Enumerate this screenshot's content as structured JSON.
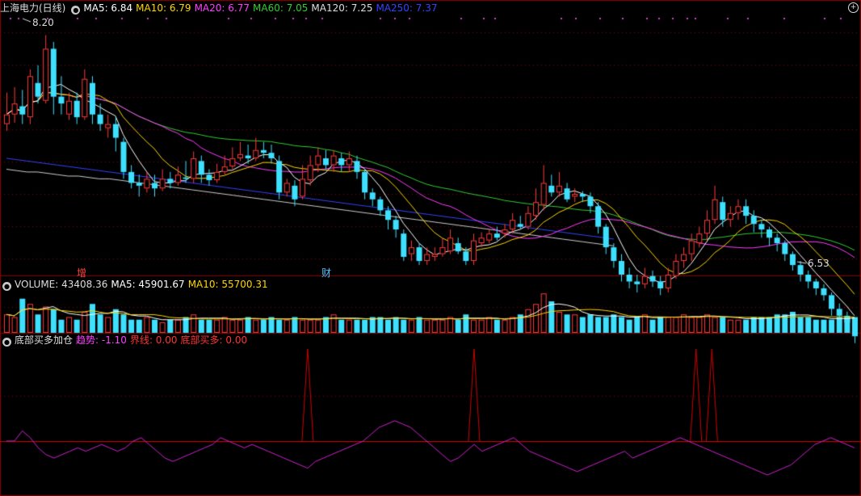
{
  "colors": {
    "up": "#ff3b3b",
    "down": "#3ee0ff",
    "ma5": "#ffffff",
    "ma10": "#ffd700",
    "ma20": "#ff3cff",
    "ma60": "#33cc33",
    "ma120": "#cccccc",
    "ma250": "#3344ff",
    "grid": "#8a0000",
    "trend": "#d020d0",
    "bottom": "#d00000"
  },
  "header": {
    "title": "上海电力(日线)",
    "ma5": "MA5: 6.84",
    "ma10": "MA10: 6.79",
    "ma20": "MA20: 6.77",
    "ma60": "MA60: 7.05",
    "ma120": "MA120: 7.25",
    "ma250": "MA250: 7.37"
  },
  "volume_header": {
    "title": "VOLUME: 43408.36",
    "ma5": "MA5: 45901.67",
    "ma10": "MA10: 55700.31"
  },
  "indicator_header": {
    "title": "底部买多加仓",
    "trend": "趋势: -1.10",
    "line": "界线: 0.00",
    "bottom": "底部买多: 0.00"
  },
  "annotations": {
    "high": "8.20",
    "low": "6.53",
    "marker1": "增",
    "marker2": "财"
  },
  "icons": {
    "panel": "settings-dot-icon",
    "corner": "expand-icon"
  },
  "chart_data": [
    {
      "type": "candlestick",
      "title": "上海电力(日线)",
      "ylim": [
        6.45,
        8.35
      ],
      "candles": [
        [
          7.55,
          7.62,
          7.78,
          7.5
        ],
        [
          7.62,
          7.7,
          7.82,
          7.56
        ],
        [
          7.68,
          7.62,
          7.8,
          7.55
        ],
        [
          7.6,
          7.9,
          7.95,
          7.55
        ],
        [
          7.85,
          7.75,
          7.98,
          7.7
        ],
        [
          7.72,
          8.1,
          8.2,
          7.7
        ],
        [
          8.1,
          7.75,
          8.15,
          7.62
        ],
        [
          7.75,
          7.7,
          7.9,
          7.62
        ],
        [
          7.62,
          7.72,
          7.78,
          7.58
        ],
        [
          7.72,
          7.6,
          7.78,
          7.55
        ],
        [
          7.6,
          7.88,
          7.95,
          7.58
        ],
        [
          7.85,
          7.62,
          7.9,
          7.55
        ],
        [
          7.62,
          7.55,
          7.7,
          7.5
        ],
        [
          7.52,
          7.55,
          7.62,
          7.45
        ],
        [
          7.55,
          7.45,
          7.6,
          7.35
        ],
        [
          7.42,
          7.2,
          7.45,
          7.15
        ],
        [
          7.2,
          7.12,
          7.25,
          7.08
        ],
        [
          7.12,
          7.1,
          7.18,
          7.02
        ],
        [
          7.08,
          7.15,
          7.2,
          7.05
        ],
        [
          7.12,
          7.08,
          7.18,
          7.02
        ],
        [
          7.08,
          7.15,
          7.22,
          7.06
        ],
        [
          7.15,
          7.12,
          7.2,
          7.08
        ],
        [
          7.12,
          7.18,
          7.24,
          7.1
        ],
        [
          7.16,
          7.15,
          7.28,
          7.12
        ],
        [
          7.15,
          7.3,
          7.35,
          7.12
        ],
        [
          7.28,
          7.18,
          7.32,
          7.12
        ],
        [
          7.18,
          7.14,
          7.22,
          7.1
        ],
        [
          7.14,
          7.2,
          7.26,
          7.12
        ],
        [
          7.2,
          7.24,
          7.32,
          7.18
        ],
        [
          7.24,
          7.3,
          7.38,
          7.22
        ],
        [
          7.3,
          7.33,
          7.42,
          7.28
        ],
        [
          7.32,
          7.3,
          7.4,
          7.26
        ],
        [
          7.3,
          7.36,
          7.45,
          7.28
        ],
        [
          7.36,
          7.34,
          7.42,
          7.3
        ],
        [
          7.34,
          7.3,
          7.4,
          7.26
        ],
        [
          7.28,
          7.05,
          7.32,
          7.0
        ],
        [
          7.05,
          7.12,
          7.15,
          7.02
        ],
        [
          7.1,
          7.0,
          7.14,
          6.95
        ],
        [
          7.02,
          7.15,
          7.25,
          7.0
        ],
        [
          7.14,
          7.25,
          7.32,
          7.1
        ],
        [
          7.25,
          7.32,
          7.38,
          7.2
        ],
        [
          7.3,
          7.25,
          7.36,
          7.22
        ],
        [
          7.25,
          7.32,
          7.36,
          7.2
        ],
        [
          7.3,
          7.25,
          7.34,
          7.2
        ],
        [
          7.25,
          7.3,
          7.35,
          7.2
        ],
        [
          7.28,
          7.2,
          7.32,
          7.15
        ],
        [
          7.2,
          7.05,
          7.22,
          7.0
        ],
        [
          7.05,
          7.0,
          7.08,
          6.95
        ],
        [
          7.0,
          6.92,
          7.02,
          6.88
        ],
        [
          6.92,
          6.85,
          6.95,
          6.78
        ],
        [
          6.85,
          6.78,
          6.88,
          6.72
        ],
        [
          6.75,
          6.58,
          6.78,
          6.55
        ],
        [
          6.6,
          6.65,
          6.7,
          6.55
        ],
        [
          6.65,
          6.55,
          6.68,
          6.52
        ],
        [
          6.55,
          6.6,
          6.65,
          6.52
        ],
        [
          6.58,
          6.6,
          6.65,
          6.55
        ],
        [
          6.6,
          6.65,
          6.72,
          6.58
        ],
        [
          6.62,
          6.72,
          6.78,
          6.6
        ],
        [
          6.68,
          6.62,
          6.72,
          6.6
        ],
        [
          6.62,
          6.55,
          6.65,
          6.52
        ],
        [
          6.55,
          6.7,
          6.75,
          6.52
        ],
        [
          6.68,
          6.72,
          6.76,
          6.65
        ],
        [
          6.7,
          6.75,
          6.78,
          6.68
        ],
        [
          6.75,
          6.72,
          6.8,
          6.7
        ],
        [
          6.75,
          6.78,
          6.82,
          6.72
        ],
        [
          6.78,
          6.85,
          6.9,
          6.75
        ],
        [
          6.82,
          6.8,
          6.88,
          6.78
        ],
        [
          6.8,
          6.9,
          6.95,
          6.78
        ],
        [
          6.88,
          6.98,
          7.08,
          6.85
        ],
        [
          6.96,
          7.12,
          7.25,
          6.92
        ],
        [
          7.1,
          7.05,
          7.18,
          7.02
        ],
        [
          7.05,
          7.1,
          7.2,
          7.02
        ],
        [
          7.08,
          7.0,
          7.12,
          6.98
        ],
        [
          7.02,
          7.04,
          7.08,
          6.98
        ],
        [
          7.04,
          7.02,
          7.06,
          6.98
        ],
        [
          7.02,
          6.95,
          7.05,
          6.9
        ],
        [
          6.95,
          6.8,
          6.98,
          6.75
        ],
        [
          6.8,
          6.65,
          6.82,
          6.6
        ],
        [
          6.65,
          6.55,
          6.68,
          6.5
        ],
        [
          6.55,
          6.45,
          6.6,
          6.4
        ],
        [
          6.45,
          6.4,
          6.5,
          6.35
        ],
        [
          6.4,
          6.38,
          6.45,
          6.32
        ],
        [
          6.38,
          6.44,
          6.5,
          6.35
        ],
        [
          6.44,
          6.4,
          6.48,
          6.36
        ],
        [
          6.4,
          6.35,
          6.44,
          6.3
        ],
        [
          6.35,
          6.45,
          6.5,
          6.32
        ],
        [
          6.44,
          6.55,
          6.6,
          6.42
        ],
        [
          6.55,
          6.6,
          6.65,
          6.5
        ],
        [
          6.6,
          6.7,
          6.75,
          6.55
        ],
        [
          6.68,
          6.75,
          6.8,
          6.65
        ],
        [
          6.75,
          6.85,
          6.92,
          6.7
        ],
        [
          6.85,
          7.0,
          7.1,
          6.82
        ],
        [
          6.98,
          6.85,
          7.02,
          6.8
        ],
        [
          6.85,
          6.9,
          6.95,
          6.8
        ],
        [
          6.9,
          6.95,
          7.0,
          6.85
        ],
        [
          6.95,
          6.88,
          7.0,
          6.82
        ],
        [
          6.88,
          6.82,
          6.92,
          6.76
        ],
        [
          6.82,
          6.78,
          6.85,
          6.72
        ],
        [
          6.78,
          6.72,
          6.8,
          6.66
        ],
        [
          6.72,
          6.68,
          6.75,
          6.62
        ],
        [
          6.68,
          6.6,
          6.7,
          6.55
        ],
        [
          6.6,
          6.52,
          6.62,
          6.48
        ],
        [
          6.52,
          6.45,
          6.55,
          6.4
        ],
        [
          6.45,
          6.4,
          6.48,
          6.35
        ],
        [
          6.4,
          6.35,
          6.42,
          6.3
        ],
        [
          6.35,
          6.3,
          6.38,
          6.26
        ],
        [
          6.3,
          6.2,
          6.32,
          6.15
        ],
        [
          6.2,
          6.15,
          6.24,
          6.1
        ],
        [
          6.15,
          6.1,
          6.18,
          6.05
        ],
        [
          6.1,
          6.0,
          6.12,
          5.95
        ]
      ],
      "ma_series": [
        {
          "name": "MA250",
          "values": [
            7.3,
            7.29,
            7.28,
            7.27,
            7.26,
            7.25,
            7.24,
            7.23,
            7.22,
            7.21,
            7.2,
            7.19,
            7.18,
            7.17,
            7.16,
            7.15,
            7.14,
            7.13,
            7.12,
            7.11,
            7.1,
            7.09,
            7.08,
            7.07,
            7.06,
            7.05,
            7.04,
            7.03,
            7.02,
            7.01,
            7.0,
            6.99,
            6.98,
            6.97,
            6.96,
            6.95,
            6.94,
            6.93,
            6.92,
            6.91,
            6.9,
            6.89,
            6.88,
            6.87,
            6.86,
            6.85,
            6.84,
            6.83,
            6.82,
            6.81,
            6.8,
            6.79,
            6.78,
            6.77,
            6.76,
            6.75,
            6.74,
            6.73,
            6.72,
            6.71
          ]
        },
        {
          "name": "MA120",
          "values": [
            7.22,
            7.21,
            7.2,
            7.2,
            7.19,
            7.18,
            7.17,
            7.17,
            7.16,
            7.15,
            7.15,
            7.14,
            7.13,
            7.12,
            7.11,
            7.1,
            7.09,
            7.08,
            7.07,
            7.06,
            7.05,
            7.04,
            7.03,
            7.02,
            7.01,
            7.0,
            6.99,
            6.98,
            6.97,
            6.96,
            6.95,
            6.94,
            6.93,
            6.92,
            6.91,
            6.9,
            6.89,
            6.88,
            6.87,
            6.86,
            6.85,
            6.84,
            6.83,
            6.82,
            6.81,
            6.8,
            6.79,
            6.78,
            6.77,
            6.76,
            6.75,
            6.74,
            6.73,
            6.72,
            6.71,
            6.7,
            6.69,
            6.68,
            6.67,
            6.66
          ]
        }
      ],
      "annotations": {
        "high": 8.2,
        "low": 6.53
      }
    },
    {
      "type": "bar",
      "title": "VOLUME",
      "values": [
        14,
        12,
        26,
        22,
        14,
        20,
        18,
        10,
        12,
        10,
        16,
        22,
        14,
        12,
        18,
        14,
        10,
        10,
        12,
        10,
        8,
        10,
        10,
        12,
        14,
        10,
        10,
        10,
        12,
        10,
        10,
        12,
        10,
        10,
        12,
        10,
        10,
        12,
        10,
        10,
        10,
        12,
        14,
        10,
        10,
        10,
        10,
        12,
        12,
        10,
        12,
        10,
        10,
        12,
        10,
        10,
        10,
        12,
        10,
        14,
        10,
        10,
        12,
        10,
        10,
        12,
        14,
        18,
        22,
        30,
        24,
        16,
        14,
        14,
        12,
        14,
        12,
        12,
        14,
        12,
        10,
        12,
        14,
        10,
        12,
        12,
        12,
        14,
        12,
        12,
        14,
        12,
        12,
        10,
        10,
        10,
        12,
        12,
        12,
        14,
        14,
        16,
        12,
        12,
        10,
        10,
        10,
        12,
        12,
        12
      ]
    },
    {
      "type": "line",
      "title": "底部买多加仓",
      "series": [
        {
          "name": "趋势",
          "values": [
            0,
            0,
            6,
            2,
            -4,
            -8,
            -10,
            -8,
            -6,
            -4,
            -6,
            -4,
            -2,
            -4,
            -6,
            -4,
            0,
            2,
            -2,
            -6,
            -10,
            -12,
            -10,
            -8,
            -6,
            -4,
            -2,
            2,
            0,
            -2,
            -4,
            -2,
            -4,
            -6,
            -8,
            -10,
            -12,
            -14,
            -16,
            -12,
            -10,
            -8,
            -6,
            -4,
            -2,
            0,
            4,
            8,
            10,
            12,
            10,
            8,
            4,
            0,
            -4,
            -8,
            -12,
            -10,
            -6,
            -2,
            -6,
            -4,
            -2,
            0,
            2,
            -2,
            -6,
            -8,
            -10,
            -12,
            -14,
            -16,
            -18,
            -16,
            -14,
            -12,
            -10,
            -8,
            -6,
            -10,
            -8,
            -6,
            -4,
            -2,
            0,
            2,
            0,
            -2,
            -4,
            -6,
            -8,
            -10,
            -12,
            -14,
            -16,
            -18,
            -20,
            -18,
            -16,
            -14,
            -10,
            -6,
            -2,
            0,
            2,
            0,
            -2,
            -4
          ]
        },
        {
          "name": "底部买多",
          "spikes": [
            38,
            59,
            87,
            89
          ]
        }
      ]
    }
  ]
}
